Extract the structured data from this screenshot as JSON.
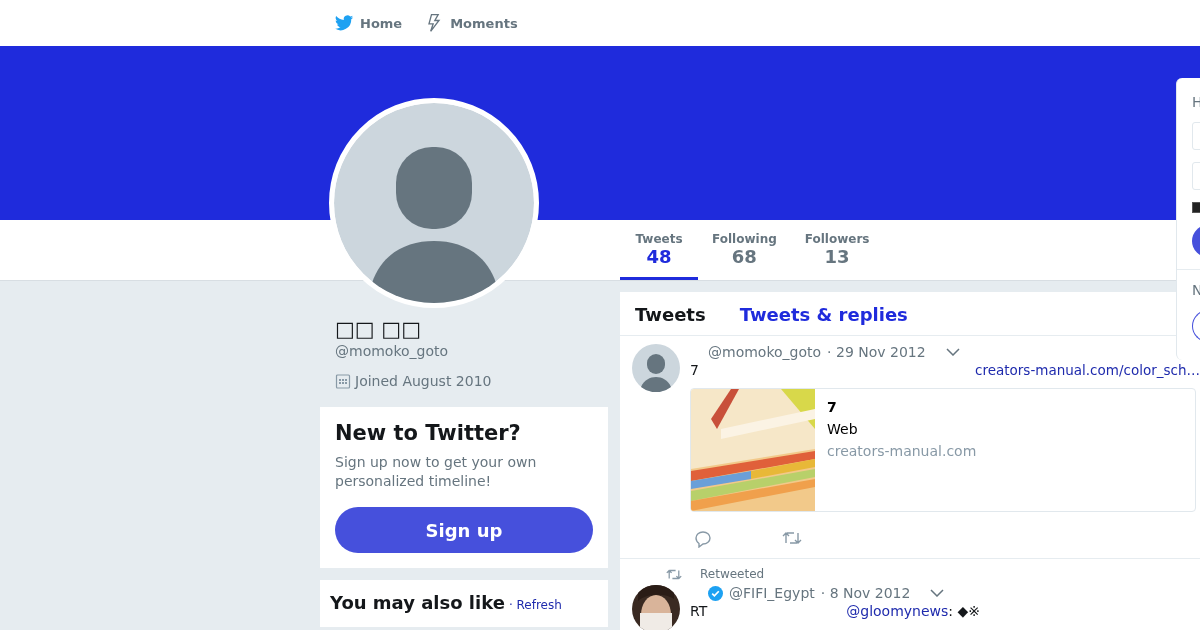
{
  "nav": [
    {
      "label": "Home"
    },
    {
      "label": "Moments"
    }
  ],
  "profile": {
    "name": "□□ □□",
    "handle": "@momoko_goto",
    "joined": "Joined August 2010"
  },
  "stats": [
    {
      "label": "Tweets",
      "value": "48",
      "selected": true
    },
    {
      "label": "Following",
      "value": "68",
      "selected": false
    },
    {
      "label": "Followers",
      "value": "13",
      "selected": false
    }
  ],
  "signup_card": {
    "title": "New to Twitter?",
    "text": "Sign up now to get your own personalized timeline!",
    "button": "Sign up"
  },
  "also_like": {
    "title": "You may also like",
    "refresh": "· Refresh"
  },
  "timeline_tabs": [
    {
      "label": "Tweets",
      "selected": true
    },
    {
      "label": "Tweets & replies",
      "selected": false
    }
  ],
  "tweets": [
    {
      "kind": "tweet",
      "handle": "@momoko_goto",
      "date": "· 29 Nov 2012",
      "text": "7",
      "link": "creators-manual.com/color_sch…",
      "card": {
        "title": "7",
        "description": "Web",
        "domain": "creators-manual.com"
      }
    },
    {
      "kind": "retweet",
      "retweeted": "Retweeted",
      "verified": true,
      "handle": "@FIFI_Egypt",
      "date": "· 8 Nov 2012",
      "text": "RT",
      "link": "@gloomynews",
      "rest": ": ◆※"
    }
  ],
  "side_panel": {
    "heading": "H",
    "checked": true,
    "heading_2": "N"
  }
}
